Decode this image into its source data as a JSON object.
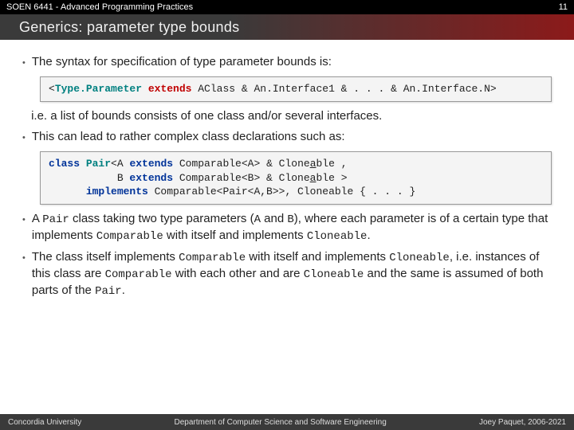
{
  "top": {
    "course": "SOEN 6441 - Advanced Programming Practices",
    "page": "11"
  },
  "title": "Generics: parameter type bounds",
  "b1": "The syntax for specification of type parameter bounds is:",
  "code1": {
    "lt": "<",
    "tp": "Type.Parameter",
    "ext": "extends",
    "rest": " AClass & An.Interface1 & . . . & An.Interface.N",
    "gt": ">"
  },
  "b2a": "i.e. a list of bounds consists of one class and/or several interfaces.",
  "b2": "This can lead to rather complex class declarations such as:",
  "code2": {
    "l1a": "class ",
    "l1b": "Pair",
    "l1c": "<A ",
    "l1d": "extends",
    "l1e": " Comparable<A> & Clone",
    "l1f": "a",
    "l1g": "ble ,",
    "l2a": "           B ",
    "l2b": "extends",
    "l2c": " Comparable<B> & Clone",
    "l2d": "a",
    "l2e": "ble >",
    "l3a": "      ",
    "l3b": "implements",
    "l3c": " Comparable<Pair<A,B>>, Cloneable { . . . }"
  },
  "b3": {
    "pre": "A ",
    "pair": "Pair",
    "mid": " class taking two type parameters (",
    "A": "A",
    "and": " and ",
    "B": "B",
    "post": "), where each parameter is of a certain type that implements ",
    "comp": "Comparable",
    "post2": " with itself and implements ",
    "clone": "Cloneable",
    "dot": "."
  },
  "b4": {
    "pre": "The class itself implements ",
    "comp": "Comparable",
    "mid": " with itself and implements ",
    "clone": "Cloneable",
    "mid2": ", i.e. instances of this class are ",
    "comp2": "Comparable",
    "mid3": " with each other and are ",
    "clone2": "Cloneable",
    "mid4": " and the same is assumed of both parts of the ",
    "pair": "Pair",
    "dot": "."
  },
  "footer": {
    "left": "Concordia University",
    "center": "Department of Computer Science and Software Engineering",
    "right": "Joey Paquet, 2006-2021"
  }
}
